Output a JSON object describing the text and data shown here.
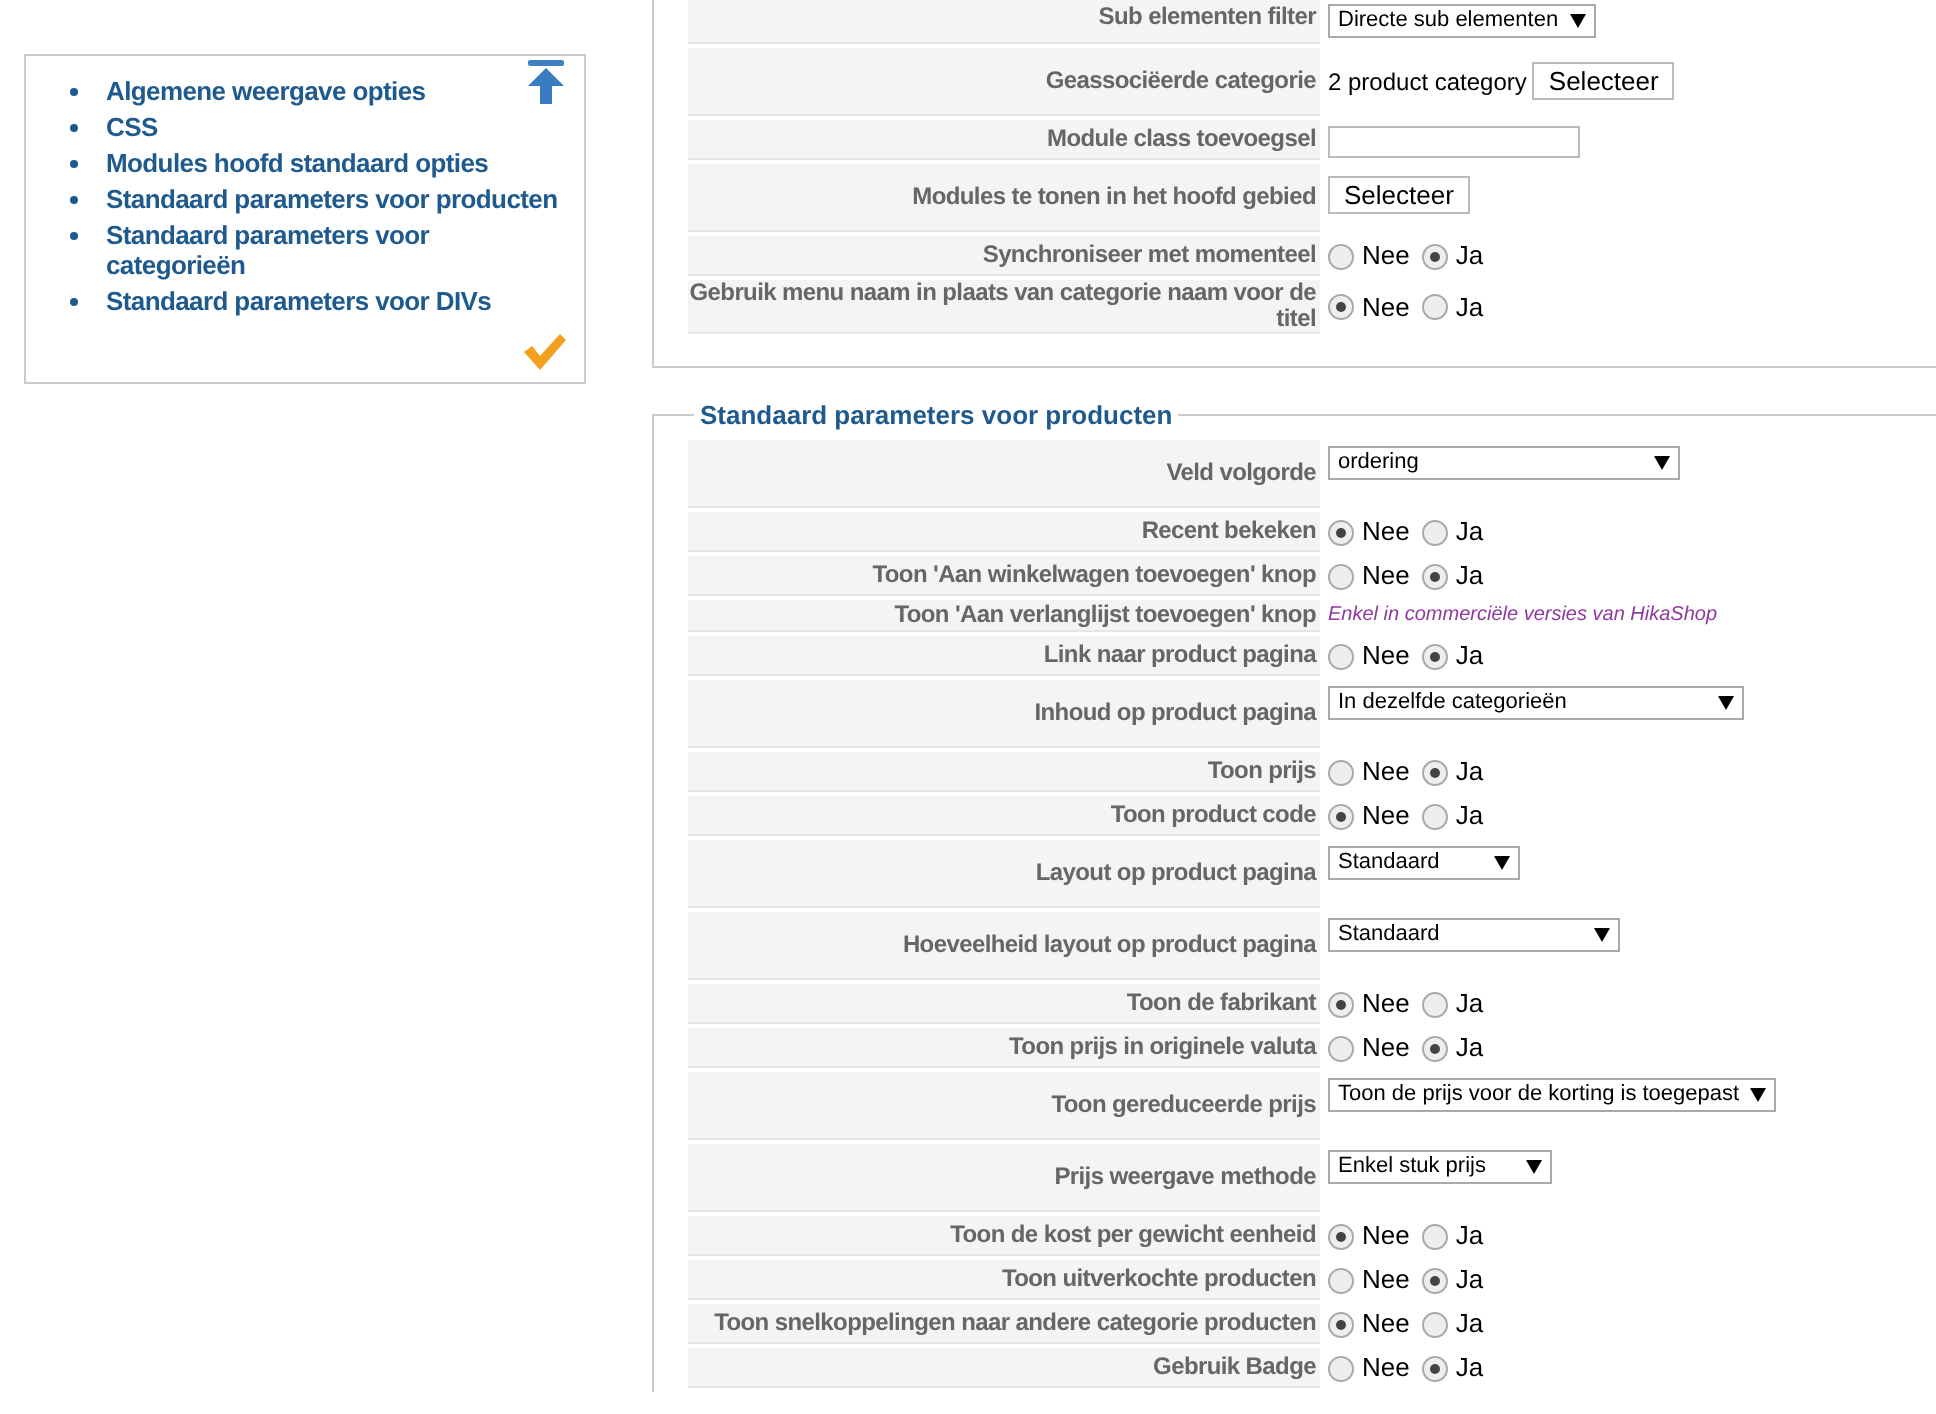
{
  "sidebar": {
    "links": [
      "Algemene weergave opties",
      "CSS",
      "Modules hoofd standaard opties",
      "Standaard parameters voor producten",
      "Standaard parameters voor categorieën",
      "Standaard parameters voor DIVs"
    ]
  },
  "sections": [
    {
      "rows": [
        {
          "label": "Sub elementen filter",
          "kind": "select",
          "value": "Directe sub elementen"
        },
        {
          "label": "Geassociëerde categorie",
          "kind": "category",
          "value": "2 product category",
          "button": "Selecteer"
        },
        {
          "label": "Module class toevoegsel",
          "kind": "input"
        },
        {
          "label": "Modules te tonen in het hoofd gebied",
          "kind": "button",
          "button": "Selecteer"
        },
        {
          "label": "Synchroniseer met momenteel",
          "kind": "radio",
          "options": [
            {
              "label": "Nee",
              "selected": false
            },
            {
              "label": "Ja",
              "selected": true
            }
          ]
        },
        {
          "label": "Gebruik menu naam in plaats van categorie naam voor de titel",
          "kind": "radio",
          "options": [
            {
              "label": "Nee",
              "selected": true
            },
            {
              "label": "Ja",
              "selected": false
            }
          ]
        }
      ]
    },
    {
      "legend": "Standaard parameters voor producten",
      "rows": [
        {
          "label": "Veld volgorde",
          "kind": "select",
          "value": "ordering"
        },
        {
          "label": "Recent bekeken",
          "kind": "radio",
          "options": [
            {
              "label": "Nee",
              "selected": true
            },
            {
              "label": "Ja",
              "selected": false
            }
          ]
        },
        {
          "label": "Toon 'Aan winkelwagen toevoegen' knop",
          "kind": "radio",
          "options": [
            {
              "label": "Nee",
              "selected": false
            },
            {
              "label": "Ja",
              "selected": true
            }
          ]
        },
        {
          "label": "Toon 'Aan verlanglijst toevoegen' knop",
          "kind": "note",
          "value": "Enkel in commerciële versies van HikaShop"
        },
        {
          "label": "Link naar product pagina",
          "kind": "radio",
          "options": [
            {
              "label": "Nee",
              "selected": false
            },
            {
              "label": "Ja",
              "selected": true
            }
          ]
        },
        {
          "label": "Inhoud op product pagina",
          "kind": "select",
          "value": "In dezelfde categorieën"
        },
        {
          "label": "Toon prijs",
          "kind": "radio",
          "options": [
            {
              "label": "Nee",
              "selected": false
            },
            {
              "label": "Ja",
              "selected": true
            }
          ]
        },
        {
          "label": "Toon product code",
          "kind": "radio",
          "options": [
            {
              "label": "Nee",
              "selected": true
            },
            {
              "label": "Ja",
              "selected": false
            }
          ]
        },
        {
          "label": "Layout op product pagina",
          "kind": "select",
          "value": "Standaard"
        },
        {
          "label": "Hoeveelheid layout op product pagina",
          "kind": "select",
          "value": "Standaard"
        },
        {
          "label": "Toon de fabrikant",
          "kind": "radio",
          "options": [
            {
              "label": "Nee",
              "selected": true
            },
            {
              "label": "Ja",
              "selected": false
            }
          ]
        },
        {
          "label": "Toon prijs in originele valuta",
          "kind": "radio",
          "options": [
            {
              "label": "Nee",
              "selected": false
            },
            {
              "label": "Ja",
              "selected": true
            }
          ]
        },
        {
          "label": "Toon gereduceerde prijs",
          "kind": "select",
          "value": "Toon de prijs voor de korting is toegepast"
        },
        {
          "label": "Prijs weergave methode",
          "kind": "select",
          "value": "Enkel stuk prijs"
        },
        {
          "label": "Toon de kost per gewicht eenheid",
          "kind": "radio",
          "options": [
            {
              "label": "Nee",
              "selected": true
            },
            {
              "label": "Ja",
              "selected": false
            }
          ]
        },
        {
          "label": "Toon uitverkochte producten",
          "kind": "radio",
          "options": [
            {
              "label": "Nee",
              "selected": false
            },
            {
              "label": "Ja",
              "selected": true
            }
          ]
        },
        {
          "label": "Toon snelkoppelingen naar andere categorie producten",
          "kind": "radio",
          "options": [
            {
              "label": "Nee",
              "selected": true
            },
            {
              "label": "Ja",
              "selected": false
            }
          ]
        },
        {
          "label": "Gebruik Badge",
          "kind": "radio",
          "options": [
            {
              "label": "Nee",
              "selected": false
            },
            {
              "label": "Ja",
              "selected": true
            }
          ]
        }
      ]
    }
  ]
}
